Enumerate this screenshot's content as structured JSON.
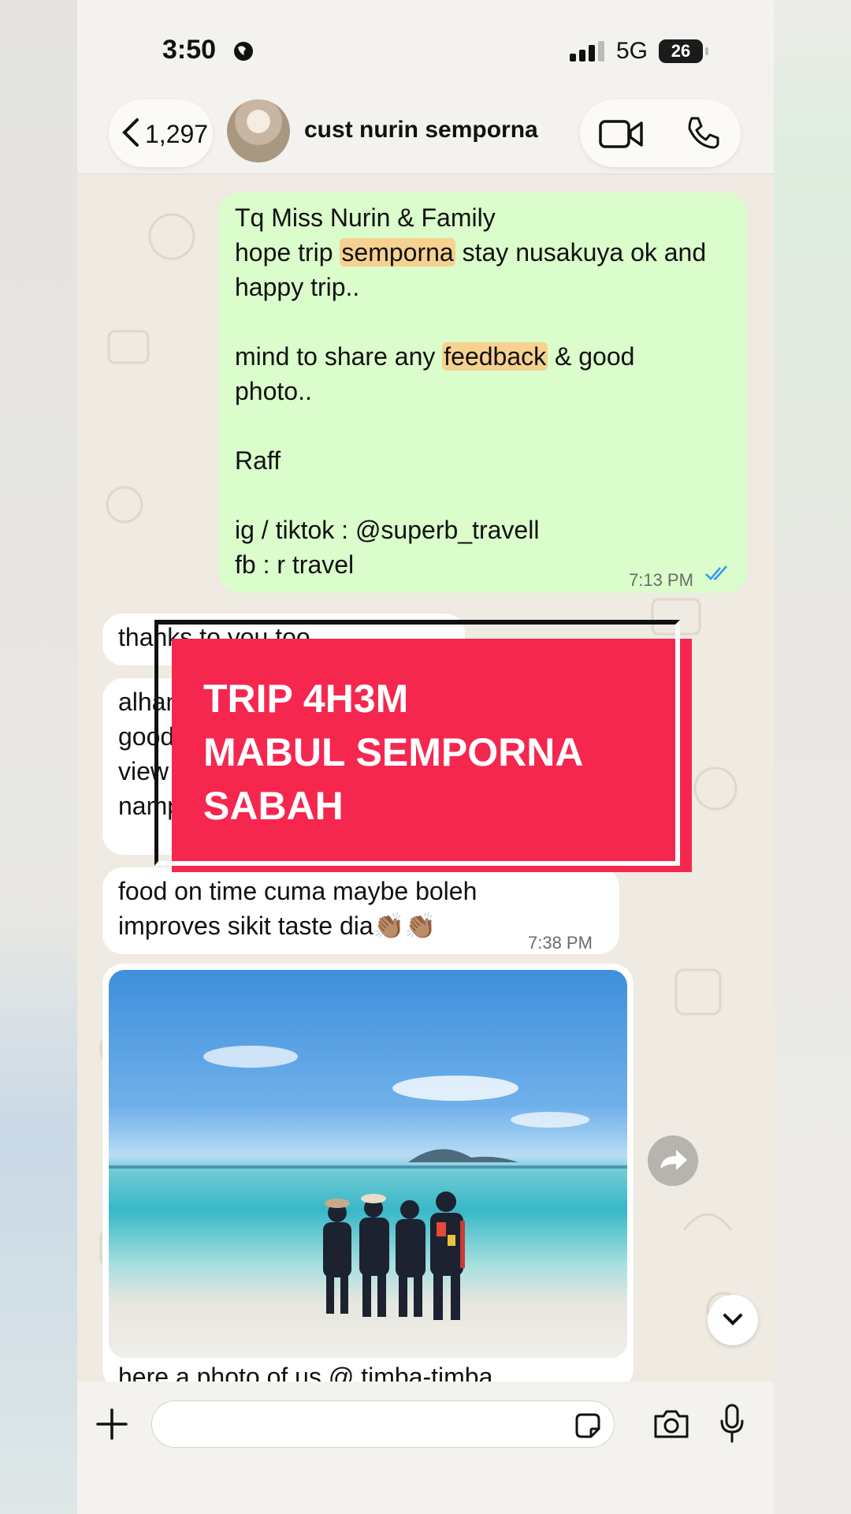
{
  "status": {
    "time": "3:50",
    "network": "5G",
    "battery": "26"
  },
  "header": {
    "back_count": "1,297",
    "contact_name": "cust nurin semporna"
  },
  "outgoing": {
    "line1": "Tq Miss Nurin & Family",
    "line2_pre": "hope trip ",
    "line2_hl": "semporna",
    "line2_post": " stay nusakuya ok and",
    "line3": "happy trip..",
    "line5_pre": "mind to share any ",
    "line5_hl": "feedback",
    "line5_post": " & good",
    "line6": "photo..",
    "line8": "Raff",
    "line10": "ig / tiktok : @superb_travell",
    "line11": "fb : r travel",
    "time": "7:13 PM"
  },
  "incoming": [
    {
      "text": "thanks to you too"
    },
    {
      "text": "alhamdulillah\ngood\nview\nnamp"
    },
    {
      "text": "food on time cuma maybe boleh\nimproves sikit taste dia👏🏽👏🏽",
      "time": "7:38 PM"
    }
  ],
  "photo_caption": "here a photo of us @ timba-timba",
  "promo": {
    "line1": "TRIP 4H3M",
    "line2": "MABUL SEMPORNA",
    "line3": "SABAH"
  },
  "icons": [
    "globe-icon",
    "signal-icon",
    "back-chevron-icon",
    "video-call-icon",
    "phone-call-icon",
    "forward-icon",
    "chevron-down-icon",
    "plus-icon",
    "sticker-icon",
    "camera-icon",
    "mic-icon",
    "read-receipt-icon"
  ],
  "colors": {
    "outgoing_bubble": "#dafdcb",
    "highlight": "#f6d18f",
    "promo": "#f5274f",
    "chat_bg": "#efeae2",
    "read_tick": "#3497f9"
  }
}
